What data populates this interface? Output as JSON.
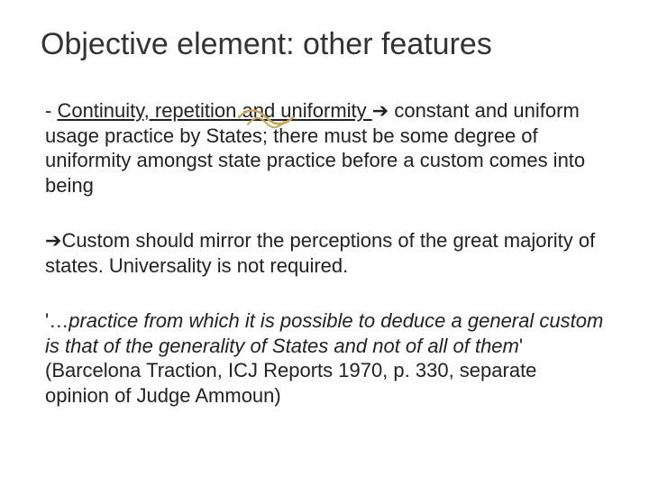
{
  "title": "Objective element: other features",
  "para1": {
    "prefix": "- ",
    "underlined": "Continuity, repetition and uniformity ",
    "arrow": "➔",
    "rest": " constant and uniform usage practice by States; there must be some degree of uniformity amongst state practice before a custom comes into being"
  },
  "para2": {
    "arrow": "➔",
    "text": "Custom should mirror the perceptions of the great majority of states. Universality is not required."
  },
  "para3": {
    "quote_open": "'…",
    "italic": "practice from which it is possible to deduce a general custom is that of the generality of States and not of all of them",
    "quote_close": "' (Barcelona Traction, ICJ Reports 1970, p. 330, separate opinion of Judge Ammoun)"
  }
}
